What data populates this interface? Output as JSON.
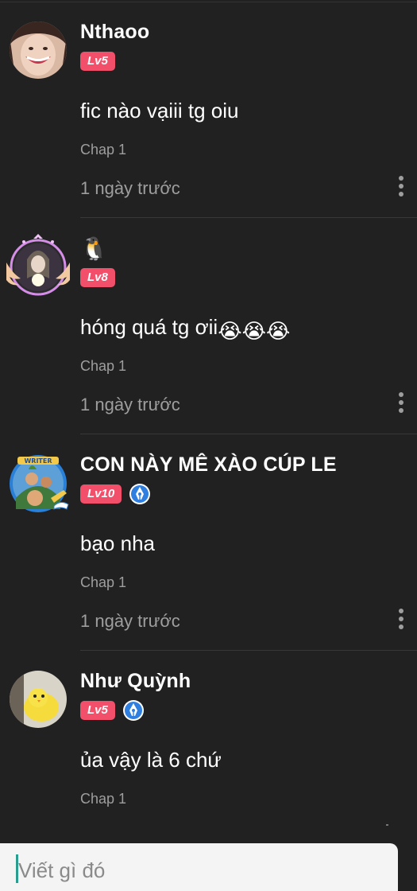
{
  "comments": [
    {
      "username": "Nthaoo",
      "level": "Lv5",
      "has_writer_badge": false,
      "text": "fic nào vạiii tg oiu",
      "chapter": "Chap 1",
      "time": "1 ngày trước",
      "avatar": "girl-smiling-avatar"
    },
    {
      "username": "🐧",
      "level": "Lv8",
      "has_writer_badge": false,
      "text": "hóng quá tg ơii",
      "emoji": "😭😭😭",
      "chapter": "Chap 1",
      "time": "1 ngày trước",
      "avatar": "girl-with-wings-frame-avatar"
    },
    {
      "username": "CON NÀY MÊ XÀO CÚP LE",
      "level": "Lv10",
      "has_writer_badge": true,
      "text": "bạo nha",
      "chapter": "Chap 1",
      "time": "1 ngày trước",
      "avatar": "writer-frame-avatar",
      "frame_label": "WRITER"
    },
    {
      "username": "Như Quỳnh",
      "level": "Lv5",
      "has_writer_badge": true,
      "text": "ủa vậy là 6 chứ",
      "chapter": "Chap 1",
      "avatar": "yellow-chick-avatar"
    }
  ],
  "input": {
    "placeholder": "Viết gì đó"
  },
  "colors": {
    "background": "#212121",
    "level_badge": "#f2506a",
    "writer_badge": "#2f7fe0",
    "secondary_text": "#9e9e9e",
    "input_background": "#f4f4f4",
    "caret": "#2a9d8f"
  }
}
